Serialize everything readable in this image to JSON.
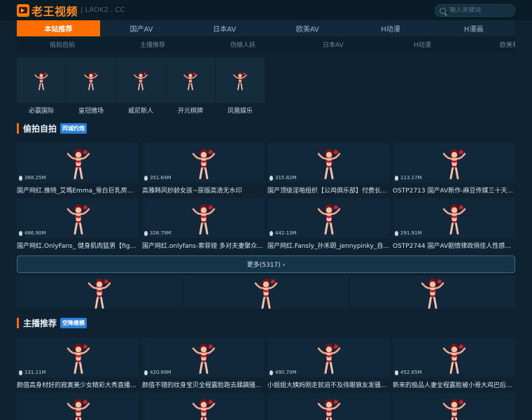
{
  "header": {
    "logo_text": "老王视频",
    "logo_domain": "| LAOK2 . CC",
    "search_placeholder": "输入关键词"
  },
  "nav_primary": [
    {
      "label": "本站推荐",
      "active": true
    },
    {
      "label": "国产AV"
    },
    {
      "label": "日本AV"
    },
    {
      "label": "欧美AV"
    },
    {
      "label": "H动漫"
    },
    {
      "label": "H漫画"
    }
  ],
  "nav_secondary": [
    "偷拍自拍",
    "主播推荐",
    "伪娘人妖",
    "日本AV",
    "H动漫",
    "欧美有"
  ],
  "apps": [
    {
      "label": "必赢国际"
    },
    {
      "label": "皇冠赌场"
    },
    {
      "label": "威尼斯人"
    },
    {
      "label": "开元棋牌"
    },
    {
      "label": "凤凰娱乐"
    }
  ],
  "section1": {
    "title": "偷拍自拍",
    "tag": "同城约炮",
    "cards": [
      {
        "views": "368.25M",
        "title": "国产网红.推特_艾瑪Emma_雪白巨乳房东..."
      },
      {
        "views": "351.64M",
        "title": "高雅韩风妙龄女孩~原版高清无水印"
      },
      {
        "views": "315.82M",
        "title": "国产顶级淫啪组织【公鸡俱乐部】付费长..."
      },
      {
        "views": "113.17M",
        "title": "OSTP2713 国产AV新作-麻豆传媒三十天..."
      },
      {
        "views": "486.90M",
        "title": "国产网红.OnlyFans_ 健身肌肉猛男【fight..."
      },
      {
        "views": "326.79M",
        "title": "国产网红.onlyfans-索菲娅 多对夫妻聚众..."
      },
      {
        "views": "442.13M",
        "title": "国产网红.Fansly_孙禾颐_jennypinky_自..."
      },
      {
        "views": "291.91M",
        "title": "OSTP2744 国产AV剧情律政俏佳人性感..."
      }
    ],
    "more_label": "更多(5317) ›"
  },
  "section2": {
    "title": "主播推荐",
    "tag": "空降嫩模",
    "cards": [
      {
        "views": "131.11M",
        "title": "颜值高身材好的寂寞美少女精彩大秀直播..."
      },
      {
        "views": "420.89M",
        "title": "颜值不错的纹身宝贝全程露脸跑去蹂躏骚..."
      },
      {
        "views": "490.70M",
        "title": "小姐姐大姨妈刚走就迫不及待跟狼友发骚..."
      },
      {
        "views": "452.65M",
        "title": "新来的极品人妻全程露脸被小哥大鸡巴后..."
      }
    ]
  },
  "colors": {
    "accent": "#ff6d00",
    "background": "#0e2232",
    "tag_blue": "#2a7fdc"
  }
}
